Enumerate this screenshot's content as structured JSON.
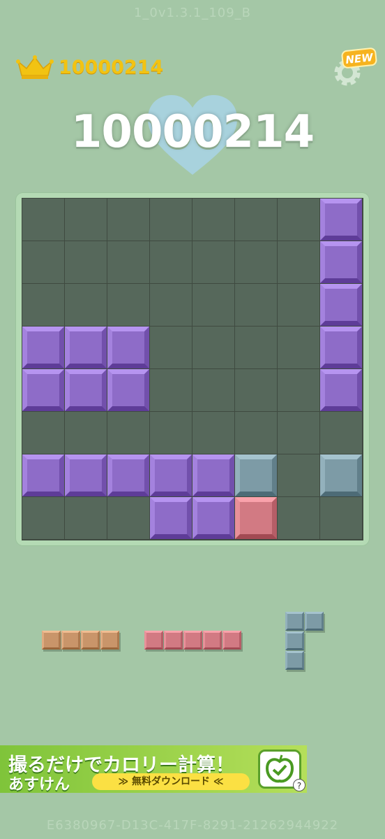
{
  "header": {
    "version": "1_0v1.3.1_109_B",
    "best_score": "10000214",
    "current_score": "10000214",
    "settings_badge": "NEW",
    "crown_icon": "crown-icon",
    "settings_icon": "gear-icon",
    "heart_icon": "heart-icon"
  },
  "colors": {
    "purple": "#8e6cc8",
    "slate": "#7d9ba6",
    "pink": "#d27a83",
    "tan": "#c9956a",
    "empty": "#56685b",
    "background": "#a4c7a6"
  },
  "board": {
    "size": 8,
    "filled": [
      {
        "row": 0,
        "col": 7,
        "color": "purple"
      },
      {
        "row": 1,
        "col": 7,
        "color": "purple"
      },
      {
        "row": 2,
        "col": 7,
        "color": "purple"
      },
      {
        "row": 3,
        "col": 0,
        "color": "purple"
      },
      {
        "row": 3,
        "col": 1,
        "color": "purple"
      },
      {
        "row": 3,
        "col": 2,
        "color": "purple"
      },
      {
        "row": 3,
        "col": 7,
        "color": "purple"
      },
      {
        "row": 4,
        "col": 0,
        "color": "purple"
      },
      {
        "row": 4,
        "col": 1,
        "color": "purple"
      },
      {
        "row": 4,
        "col": 2,
        "color": "purple"
      },
      {
        "row": 4,
        "col": 7,
        "color": "purple"
      },
      {
        "row": 6,
        "col": 0,
        "color": "purple"
      },
      {
        "row": 6,
        "col": 1,
        "color": "purple"
      },
      {
        "row": 6,
        "col": 2,
        "color": "purple"
      },
      {
        "row": 6,
        "col": 3,
        "color": "purple"
      },
      {
        "row": 6,
        "col": 4,
        "color": "purple"
      },
      {
        "row": 6,
        "col": 5,
        "color": "slate"
      },
      {
        "row": 6,
        "col": 7,
        "color": "slate"
      },
      {
        "row": 7,
        "col": 3,
        "color": "purple"
      },
      {
        "row": 7,
        "col": 4,
        "color": "purple"
      },
      {
        "row": 7,
        "col": 5,
        "color": "pink"
      }
    ]
  },
  "tray": [
    {
      "name": "tan-line-piece",
      "color": "tan",
      "cells": [
        [
          0,
          0
        ],
        [
          0,
          1
        ],
        [
          0,
          2
        ],
        [
          0,
          3
        ]
      ]
    },
    {
      "name": "pink-line-piece",
      "color": "pink",
      "cells": [
        [
          0,
          0
        ],
        [
          0,
          1
        ],
        [
          0,
          2
        ],
        [
          0,
          3
        ],
        [
          0,
          4
        ]
      ]
    },
    {
      "name": "slate-corner-piece",
      "color": "slate",
      "cells": [
        [
          0,
          0
        ],
        [
          0,
          1
        ],
        [
          1,
          0
        ],
        [
          2,
          0
        ]
      ]
    }
  ],
  "ad": {
    "line1": "撮るだけでカロリー計算！",
    "line2": "あすけん",
    "button": "≫ 無料ダウンロード ≪",
    "help": "?",
    "app_icon": "apple-icon"
  },
  "footer": {
    "device_id": "E6380967-D13C-417F-8291-21262944922"
  }
}
